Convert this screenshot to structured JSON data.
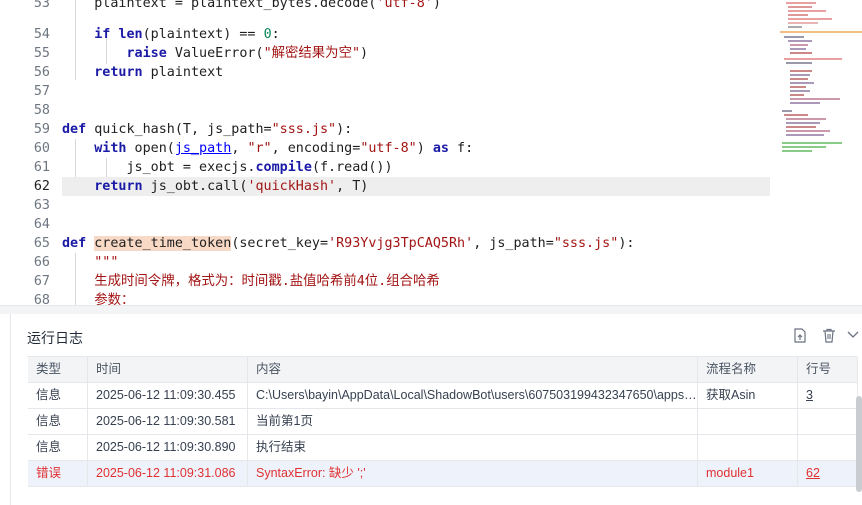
{
  "editor": {
    "lines": [
      {
        "num": "53",
        "text": "plaintext = plaintext_bytes.decode('utf-8')"
      },
      {
        "num": "54",
        "text": "if len(plaintext) == 0:"
      },
      {
        "num": "55",
        "text": "raise ValueError(\"解密结果为空\")"
      },
      {
        "num": "56",
        "text": "return plaintext"
      },
      {
        "num": "57",
        "text": ""
      },
      {
        "num": "58",
        "text": ""
      },
      {
        "num": "59",
        "text": "def quick_hash(T, js_path=\"sss.js\"):"
      },
      {
        "num": "60",
        "text": "with open(js_path, \"r\", encoding=\"utf-8\") as f:"
      },
      {
        "num": "61",
        "text": "js_obt = execjs.compile(f.read())"
      },
      {
        "num": "62",
        "text": "return js_obt.call('quickHash', T)"
      },
      {
        "num": "63",
        "text": ""
      },
      {
        "num": "64",
        "text": ""
      },
      {
        "num": "65",
        "text": "def create_time_token(secret_key='R93Yvjg3TpCAQ5Rh', js_path=\"sss.js\"):"
      },
      {
        "num": "66",
        "text": "\"\"\""
      },
      {
        "num": "67",
        "text": "生成时间令牌，格式为：时间戳.盐值哈希前4位.组合哈希"
      },
      {
        "num": "68",
        "text": "参数："
      }
    ],
    "tokens": {
      "l53_a": "plaintext = plaintext_bytes.decode(",
      "l53_b": "'utf-8'",
      "l53_c": ")",
      "l54_if": "if",
      "l54_len": "len",
      "l54_mid": "(plaintext) == ",
      "l54_zero": "0",
      "l54_end": ":",
      "l55_raise": "raise",
      "l55_mid": " ValueError(",
      "l55_str": "\"解密结果为空\"",
      "l55_end": ")",
      "l56_ret": "return",
      "l56_rest": " plaintext",
      "l59_def": "def",
      "l59_name": " quick_hash(T, js_path=",
      "l59_str": "\"sss.js\"",
      "l59_end": "):",
      "l60_with": "with",
      "l60_open": " open(",
      "l60_jspath": "js_path",
      "l60_c1": ", ",
      "l60_r": "\"r\"",
      "l60_c2": ", encoding=",
      "l60_utf": "\"utf-8\"",
      "l60_c3": ") ",
      "l60_as": "as",
      "l60_f": " f:",
      "l61_a": "js_obt = execjs.",
      "l61_compile": "compile",
      "l61_b": "(f.read())",
      "l62_ret": "return",
      "l62_a": " js_obt.call(",
      "l62_str": "'quickHash'",
      "l62_b": ", T)",
      "l65_def": "def",
      "l65_sp": " ",
      "l65_name": "create_time_token",
      "l65_a": "(secret_key=",
      "l65_key": "'R93Yvjg3TpCAQ5Rh'",
      "l65_b": ", js_path=",
      "l65_path": "\"sss.js\"",
      "l65_c": "):",
      "l66": "\"\"\"",
      "l67": "生成时间令牌，格式为：时间戳.盐值哈希前4位.组合哈希",
      "l68": "参数："
    }
  },
  "log_panel": {
    "title": "运行日志",
    "export_icon": "export-file-icon",
    "delete_icon": "trash-icon",
    "collapse_icon": "chevron-down-icon",
    "columns": [
      "类型",
      "时间",
      "内容",
      "流程名称",
      "行号"
    ],
    "rows": [
      {
        "type": "信息",
        "time": "2025-06-12 11:09:30.455",
        "content": "C:\\Users\\bayin\\AppData\\Local\\ShadowBot\\users\\607503199432347650\\apps\\...",
        "flow": "获取Asin",
        "line": "3",
        "level": "info"
      },
      {
        "type": "信息",
        "time": "2025-06-12 11:09:30.581",
        "content": "当前第1页",
        "flow": "",
        "line": "",
        "level": "info"
      },
      {
        "type": "信息",
        "time": "2025-06-12 11:09:30.890",
        "content": "执行结束",
        "flow": "",
        "line": "",
        "level": "info"
      },
      {
        "type": "错误",
        "time": "2025-06-12 11:09:31.086",
        "content": "SyntaxError: 缺少 ';'",
        "flow": "module1",
        "line": "62",
        "level": "error"
      }
    ]
  },
  "colors": {
    "error": "#e03131",
    "keyword": "#0000ff",
    "string": "#a31515",
    "selected_row": "#eef2fb"
  }
}
